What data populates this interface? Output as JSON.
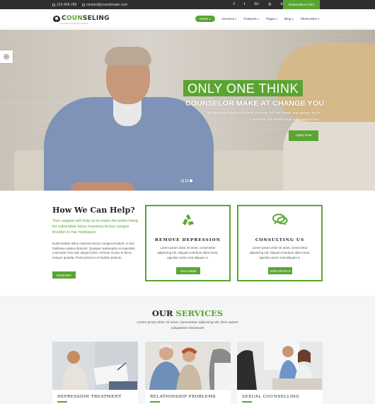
{
  "topbar": {
    "phone": "123-456-789",
    "email": "contact@yourdomain.com",
    "social_icons": [
      "facebook-icon",
      "twitter-icon",
      "google-plus-icon",
      "instagram-icon",
      "linkedin-icon"
    ],
    "reservation_label": "Reservation Form"
  },
  "header": {
    "logo_prefix": "C",
    "logo_highlight": "OUN",
    "logo_rest": "SELING",
    "logo_tagline": "Counseling & Psychology Template",
    "nav": [
      "Home",
      "Services",
      "Features",
      "Pages",
      "Blog",
      "Shortcodes"
    ]
  },
  "hero": {
    "title": "ONLY ONE THINK",
    "subtitle": "COUNSELOR MAKE AT CHANGE YOU",
    "text": "We provides always our best services for our clients and always try to achieve our client's trust and satisfaction.",
    "button": "Apply Now",
    "slide_count": 3,
    "active_slide": 3
  },
  "help": {
    "title": "How We Can Help?",
    "lead": "Your support will help us to make life better living for vulnerable tellus maximus lectus congue tincidun in hac habitasse.",
    "body": "Nulla facilisis tellus maximus lectus congue tincidunt. In hac habitasse platea dictumst. Quisque malesuada mi imperdiet, commodo eros sed, aliquet tortor. Aenean id arcu in lacus semper gravida. Proin porta leo et facilisis pretium.",
    "button": "Read More"
  },
  "cards": [
    {
      "title": "REMOVE DEPRESSION",
      "text": "Lorem ipsum dolor sit amet, consectetur adipiscing elit. Aliquam interdum diam tortor, egestas varius erat aliquam a.",
      "button": "View Details",
      "icon": "recycle-icon"
    },
    {
      "title": "CONSULTING US",
      "text": "Lorem ipsum dolor sit amet, consectetur adipiscing elit. Aliquam interdum diam tortor, egestas varius erat aliquam a.",
      "button": "VIEW DETAILS",
      "icon": "chat-bubbles-icon"
    }
  ],
  "services": {
    "title_plain": "OUR ",
    "title_highlight": "SERVICES",
    "subtitle": "Lorem ipsum dolor sit amet, consectetur adipiscing elit. Rem autem voluptatem obcaecati!",
    "items": [
      {
        "name": "DEPRESSION TREATMENT"
      },
      {
        "name": "RELATIONSHIP PROBLEMS"
      },
      {
        "name": "SEXUAL COUNSELLING"
      }
    ]
  },
  "colors": {
    "accent": "#5aa532",
    "topbar": "#2f2f2f",
    "services_bg": "#f4f5f7"
  }
}
